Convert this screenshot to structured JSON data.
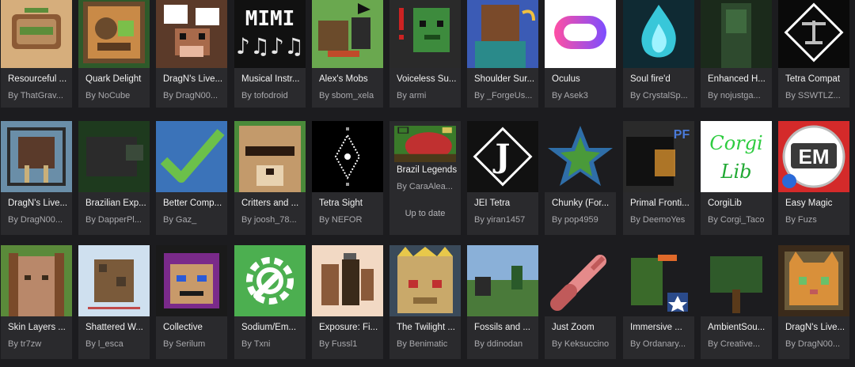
{
  "mods": [
    {
      "name": "Resourceful ...",
      "author": "By ThatGrav...",
      "icon": "resourceful-icon",
      "colors": [
        "#d6ae7c",
        "#8c5a35",
        "#5c8d3a"
      ]
    },
    {
      "name": "Quark Delight",
      "author": "By NoCube",
      "icon": "quark-delight-icon",
      "colors": [
        "#6a4a2c",
        "#c98a47",
        "#7bbf4a"
      ]
    },
    {
      "name": "DragN's Live...",
      "author": "By DragN00...",
      "icon": "cow-icon",
      "colors": [
        "#5b3a29",
        "#ffffff",
        "#a86a4b"
      ]
    },
    {
      "name": "Musical Instr...",
      "author": "By tofodroid",
      "icon": "music-notes-icon",
      "colors": [
        "#111111",
        "#ffffff",
        "#e6e6e6"
      ]
    },
    {
      "name": "Alex's Mobs",
      "author": "By sbom_xela",
      "icon": "alexs-mobs-icon",
      "colors": [
        "#6aa84f",
        "#6b4b2b",
        "#2b2b2b"
      ]
    },
    {
      "name": "Voiceless Su...",
      "author": "By armi",
      "icon": "zombie-head-icon",
      "colors": [
        "#2a2a2a",
        "#3d8b3d",
        "#cc2222"
      ]
    },
    {
      "name": "Shoulder Sur...",
      "author": "By _ForgeUs...",
      "icon": "shoulder-surfing-icon",
      "colors": [
        "#3b5bb5",
        "#7a4a2a",
        "#2a8a8a"
      ]
    },
    {
      "name": "Oculus",
      "author": "By Asek3",
      "icon": "oculus-icon",
      "colors": [
        "#ffffff",
        "#ff4fa3",
        "#7c4dff"
      ]
    },
    {
      "name": "Soul fire'd",
      "author": "By CrystalSp...",
      "icon": "soul-fire-icon",
      "colors": [
        "#0f2a33",
        "#38c7d9",
        "#9ff3ff"
      ]
    },
    {
      "name": "Enhanced H...",
      "author": "By nojustga...",
      "icon": "enhanced-hand-icon",
      "colors": [
        "#1b2a1b",
        "#2e4a2e",
        "#3f6a3f"
      ]
    },
    {
      "name": "Tetra Compat",
      "author": "By SSWTLZ...",
      "icon": "tetra-compat-icon",
      "colors": [
        "#0a0a0a",
        "#ffffff",
        "#bdbdbd"
      ]
    },
    {
      "name": "DragN's Live...",
      "author": "By DragN00...",
      "icon": "walrus-icon",
      "colors": [
        "#6a8ea8",
        "#5a3a2a",
        "#c9b07a"
      ]
    },
    {
      "name": "Brazilian Exp...",
      "author": "By DapperPl...",
      "icon": "tapir-icon",
      "colors": [
        "#1e3a1e",
        "#2b2b2b",
        "#3a4a3a"
      ]
    },
    {
      "name": "Better Comp...",
      "author": "By Gaz_",
      "icon": "checkmark-icon",
      "colors": [
        "#3b73b9",
        "#6cc04a",
        "#ffffff"
      ]
    },
    {
      "name": "Critters and ...",
      "author": "By joosh_78...",
      "icon": "critter-face-icon",
      "colors": [
        "#c39a6b",
        "#2a1a10",
        "#e8d2b0"
      ]
    },
    {
      "name": "Tetra Sight",
      "author": "By NEFOR",
      "icon": "tetra-sight-icon",
      "colors": [
        "#000000",
        "#ffffff",
        "#9a9a9a"
      ]
    },
    {
      "name": "Brazil Legends",
      "author": "By CaraAlea...",
      "icon": "brazil-legends-icon",
      "colors": [
        "#3a7a2a",
        "#c03030",
        "#d6c35a"
      ],
      "status": "Up to date"
    },
    {
      "name": "JEI Tetra",
      "author": "By yiran1457",
      "icon": "jei-tetra-icon",
      "colors": [
        "#111111",
        "#ffffff",
        "#888888"
      ]
    },
    {
      "name": "Chunky (For...",
      "author": "By pop4959",
      "icon": "chunky-star-icon",
      "colors": [
        "#1c1c1f",
        "#2f6ea8",
        "#4a9a3a"
      ]
    },
    {
      "name": "Primal Fronti...",
      "author": "By DeemoYes",
      "icon": "primal-frontier-icon",
      "colors": [
        "#2a2a2a",
        "#f0a030",
        "#4a7ad8"
      ]
    },
    {
      "name": "CorgiLib",
      "author": "By Corgi_Taco",
      "icon": "corgilib-icon",
      "colors": [
        "#ffffff",
        "#2ecc40",
        "#1fa832"
      ],
      "text": "Corgi Lib"
    },
    {
      "name": "Easy Magic",
      "author": "By Fuzs",
      "icon": "easy-magic-icon",
      "colors": [
        "#d42a2a",
        "#ffffff",
        "#2a6ad8"
      ],
      "text": "EM"
    },
    {
      "name": "Skin Layers ...",
      "author": "By tr7zw",
      "icon": "skin-layers-icon",
      "colors": [
        "#5a8a3a",
        "#b9886a",
        "#7a4a2a"
      ]
    },
    {
      "name": "Shattered W...",
      "author": "By l_esca",
      "icon": "shattered-world-icon",
      "colors": [
        "#cfe0ef",
        "#7a5a3a",
        "#4a3a2a"
      ]
    },
    {
      "name": "Collective",
      "author": "By Serilum",
      "icon": "collective-icon",
      "colors": [
        "#1a1a1a",
        "#7a2a8a",
        "#c89a6a"
      ]
    },
    {
      "name": "Sodium/Em...",
      "author": "By Txni",
      "icon": "wrench-gear-icon",
      "colors": [
        "#4caf50",
        "#ffffff",
        "#2e7d32"
      ]
    },
    {
      "name": "Exposure: Fi...",
      "author": "By Fussl1",
      "icon": "film-camera-icon",
      "colors": [
        "#f2d9c4",
        "#8a5a3a",
        "#3a2a1a"
      ]
    },
    {
      "name": "The Twilight ...",
      "author": "By Benimatic",
      "icon": "twilight-head-icon",
      "colors": [
        "#c9a96a",
        "#e8c84a",
        "#8a6a3a"
      ]
    },
    {
      "name": "Fossils and ...",
      "author": "By ddinodan",
      "icon": "fossils-landscape-icon",
      "colors": [
        "#8ab0d8",
        "#4a7a3a",
        "#2a2a2a"
      ]
    },
    {
      "name": "Just Zoom",
      "author": "By Keksuccino",
      "icon": "spyglass-icon",
      "colors": [
        "#1c1c1f",
        "#e58a8a",
        "#c05a5a"
      ]
    },
    {
      "name": "Immersive ...",
      "author": "By Ordanary...",
      "icon": "immersive-icon",
      "colors": [
        "#1c1c1f",
        "#3a6a2a",
        "#e06a2a"
      ]
    },
    {
      "name": "AmbientSou...",
      "author": "By Creative...",
      "icon": "tree-icon",
      "colors": [
        "#1c1c1f",
        "#2f5a2a",
        "#5a3a1a"
      ]
    },
    {
      "name": "DragN's Live...",
      "author": "By DragN00...",
      "icon": "cat-face-icon",
      "colors": [
        "#3a2a1a",
        "#d9903a",
        "#6ac06a"
      ]
    }
  ]
}
